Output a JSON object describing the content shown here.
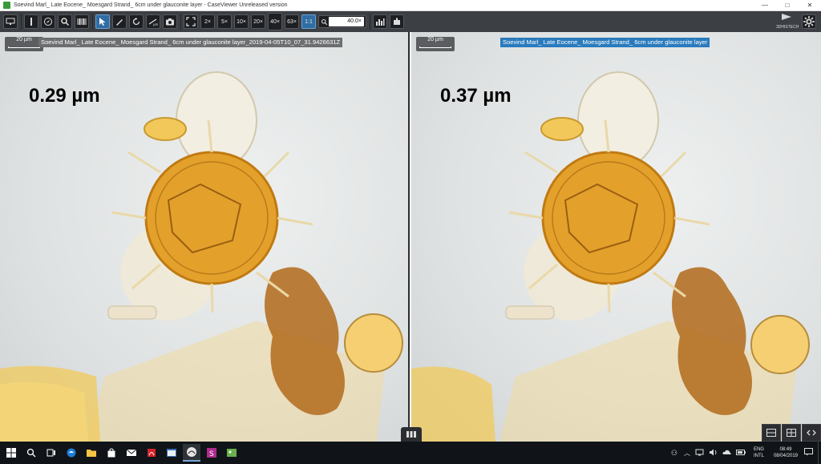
{
  "window": {
    "title": "Soevind Marl_ Late Eocene_ Moesgard Strand_ 6cm under glauconite layer - CaseViewer Unreleased version",
    "minimize": "—",
    "maximize": "□",
    "close": "✕"
  },
  "toolbar": {
    "magnifications": [
      "2×",
      "5×",
      "10×",
      "20×",
      "40×",
      "63×"
    ],
    "one_to_one": "1:1",
    "zoom_value": "40.0×",
    "logo_text": "3DHISTECH"
  },
  "viewers": {
    "left": {
      "scalebar": "20 µm",
      "image_name": "Soevind Marl_ Late Eocene_ Moesgard Strand_ 6cm under glauconite layer_2019-04-05T10_07_31.9426631Z",
      "measurement": "0.29 µm"
    },
    "right": {
      "scalebar": "20 µm",
      "image_name": "Soevind Marl_ Late Eocene_ Moesgard Strand_ 6cm under glauconite layer",
      "measurement": "0.37 µm"
    }
  },
  "taskbar": {
    "lang_top": "ENG",
    "lang_bottom": "INTL",
    "time": "08:49",
    "date": "08/04/2019"
  },
  "colors": {
    "toolbar_bg": "#3c3f44",
    "active_button": "#2f6da3",
    "selected_label": "#2a7bbd",
    "specimen_orange": "#e3a12c"
  }
}
